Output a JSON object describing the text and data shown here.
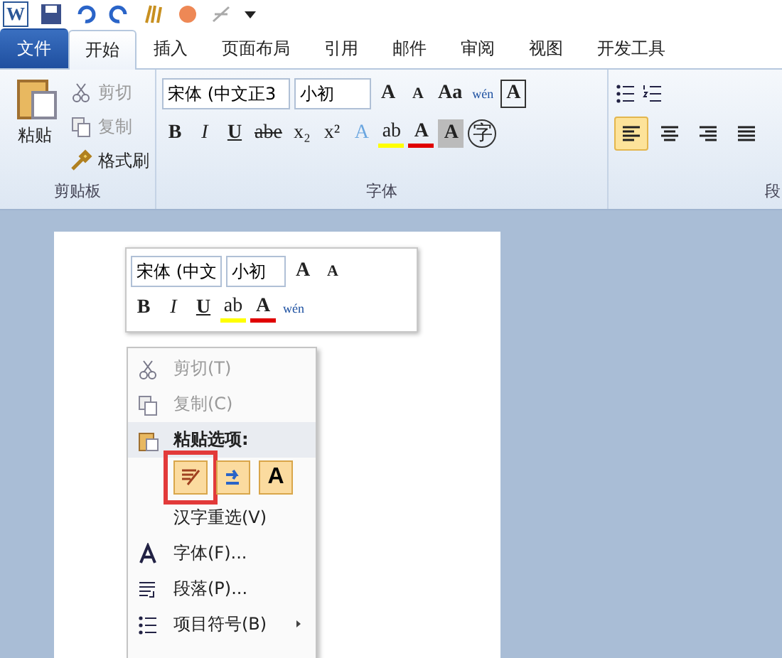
{
  "quick_access": {
    "logo": "W"
  },
  "tabs": [
    {
      "label": "文件",
      "kind": "file",
      "selected": false
    },
    {
      "label": "开始",
      "kind": "tab",
      "selected": true
    },
    {
      "label": "插入",
      "kind": "tab",
      "selected": false
    },
    {
      "label": "页面布局",
      "kind": "tab",
      "selected": false
    },
    {
      "label": "引用",
      "kind": "tab",
      "selected": false
    },
    {
      "label": "邮件",
      "kind": "tab",
      "selected": false
    },
    {
      "label": "审阅",
      "kind": "tab",
      "selected": false
    },
    {
      "label": "视图",
      "kind": "tab",
      "selected": false
    },
    {
      "label": "开发工具",
      "kind": "tab",
      "selected": false
    }
  ],
  "clipboard": {
    "paste": "粘贴",
    "cut": {
      "label": "剪切",
      "disabled": true
    },
    "copy": {
      "label": "复制",
      "disabled": true
    },
    "format_painter": {
      "label": "格式刷",
      "disabled": false
    },
    "group_label": "剪贴板"
  },
  "font": {
    "font_name": "宋体 (中文正3",
    "font_size": "小初",
    "group_label": "字体",
    "row1": [
      {
        "glyph": "A",
        "kind": "grow"
      },
      {
        "glyph": "A",
        "kind": "shrink"
      },
      {
        "glyph": "Aa",
        "kind": "case"
      },
      {
        "glyph": "wén",
        "kind": "phonetic"
      },
      {
        "glyph": "A",
        "kind": "border"
      }
    ],
    "row2": [
      {
        "glyph": "B",
        "kind": "bold"
      },
      {
        "glyph": "I",
        "kind": "italic"
      },
      {
        "glyph": "U",
        "kind": "underline"
      },
      {
        "glyph": "abe",
        "kind": "strike"
      },
      {
        "glyph": "x₂",
        "kind": "plain"
      },
      {
        "glyph": "x²",
        "kind": "plain"
      },
      {
        "glyph": "A",
        "kind": "effect"
      },
      {
        "glyph": "ab",
        "kind": "highlight"
      },
      {
        "glyph": "A",
        "kind": "color"
      },
      {
        "glyph": "A",
        "kind": "shade"
      },
      {
        "glyph": "字",
        "kind": "circle"
      }
    ]
  },
  "paragraph": {
    "group_label": "段",
    "align": [
      {
        "kind": "left",
        "selected": true
      },
      {
        "kind": "center",
        "selected": false
      },
      {
        "kind": "right",
        "selected": false
      },
      {
        "kind": "justify",
        "selected": false
      }
    ]
  },
  "mini_toolbar": {
    "font_name": "宋体 (中文",
    "font_size": "小初",
    "row1": [
      {
        "glyph": "A",
        "kind": "grow"
      },
      {
        "glyph": "A",
        "kind": "shrink"
      }
    ],
    "row2": [
      {
        "glyph": "B",
        "kind": "bold"
      },
      {
        "glyph": "I",
        "kind": "italic"
      },
      {
        "glyph": "U",
        "kind": "underline"
      },
      {
        "glyph": "ab",
        "kind": "highlight"
      },
      {
        "glyph": "A",
        "kind": "color"
      },
      {
        "glyph": "wén",
        "kind": "phonetic"
      }
    ]
  },
  "context_menu": [
    {
      "kind": "item",
      "label": "剪切(T)",
      "disabled": true
    },
    {
      "kind": "item",
      "label": "复制(C)",
      "disabled": true
    },
    {
      "kind": "header",
      "label": "粘贴选项:"
    },
    {
      "kind": "paste_options",
      "options": [
        {
          "kind": "keep",
          "selected": true
        },
        {
          "kind": "merge",
          "selected": false
        },
        {
          "kind": "text",
          "glyph": "A",
          "selected": false
        }
      ]
    },
    {
      "kind": "item",
      "label": "汉字重选(V)",
      "disabled": false
    },
    {
      "kind": "item",
      "label": "字体(F)...",
      "disabled": false
    },
    {
      "kind": "item",
      "label": "段落(P)...",
      "disabled": false
    },
    {
      "kind": "submenu",
      "label": "项目符号(B)",
      "disabled": false
    }
  ]
}
